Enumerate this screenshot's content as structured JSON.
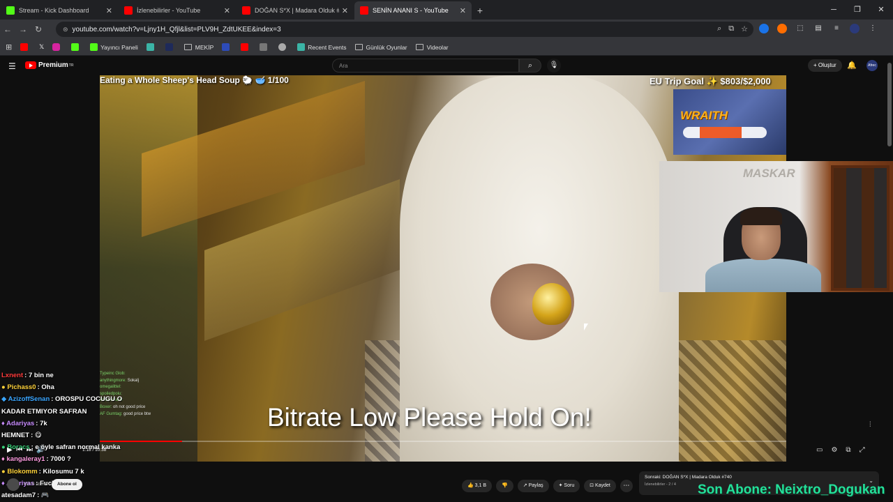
{
  "browser": {
    "tabs": [
      {
        "title": "Stream - Kick Dashboard",
        "color": "#53fc18"
      },
      {
        "title": "İzlenebilirler - YouTube",
        "color": "#ff0000"
      },
      {
        "title": "DOĞAN S*X | Madara Olduk #7",
        "color": "#ff0000"
      },
      {
        "title": "SENİN ANANI S - YouTube",
        "color": "#ff0000"
      }
    ],
    "url": "youtube.com/watch?v=Ljny1H_Qfjl&list=PLV9H_ZdtUKEE&index=3",
    "bookmarks": [
      "Yayıncı Paneli",
      "MEKİP",
      "Recent Events",
      "Günlük Oyunlar",
      "Videolar"
    ]
  },
  "youtube": {
    "logo": "Premium",
    "logo_sup": "TR",
    "search_placeholder": "Ara",
    "create_label": "Oluştur",
    "avatar_label": "Afrec"
  },
  "video": {
    "overlay_title": "Eating a Whole Sheep's Head Soup 🐑 🥣 1/100",
    "trip_goal": "EU Trip Goal ✨ $803/$2,000",
    "wraith": "WRAITH",
    "webcam_wall_logo": "MASKAR",
    "bitrate_message": "Bitrate Low Please Hold On!",
    "time": "1:18 / 10:38",
    "progress": 0.12,
    "mini_chat": [
      {
        "user": "Typeinc Glob:",
        "msg": ""
      },
      {
        "user": "anythingmore:",
        "msg": "Sokalj"
      },
      {
        "user": "omegalittel:",
        "msg": ""
      },
      {
        "user": "spoiledpoiu:",
        "msg": ""
      },
      {
        "user": "chatpassoin:",
        "msg": ""
      },
      {
        "user": "Boxer:",
        "msg": "oh not good price"
      },
      {
        "user": "AF Gumtag:",
        "msg": "good price btw"
      }
    ]
  },
  "chat": [
    {
      "user": "Lxnent",
      "color": "#ff3b3b",
      "msg": ": 7 bin ne"
    },
    {
      "user": "Pichass0",
      "color": "#ffd23a",
      "msg": ": Oha"
    },
    {
      "user": "AzizoffSenan",
      "color": "#3aa6ff",
      "msg": ": OROSPU COCUGU O"
    },
    {
      "user": "",
      "color": "#ffffff",
      "msg": "KADAR ETMIYOR SAFRAN"
    },
    {
      "user": "Adariyas",
      "color": "#c88cff",
      "msg": ": 7k"
    },
    {
      "user": "HEMNET",
      "color": "#ffffff",
      "msg": ": 😋"
    },
    {
      "user": "Boracs",
      "color": "#3ad27a",
      "msg": ": e öyle safran normal kanka"
    },
    {
      "user": "kangaleray1",
      "color": "#ff9be0",
      "msg": ": 7000 ?"
    },
    {
      "user": "Blokomm",
      "color": "#ffd23a",
      "msg": ": Kilosumu 7 k"
    },
    {
      "user": "Adariyas",
      "color": "#c88cff",
      "msg": ": Fuck amk"
    },
    {
      "user": "atesadam7",
      "color": "#ffffff",
      "msg": ": 🎮"
    }
  ],
  "actions": {
    "likes": "3,1 B",
    "share": "Paylaş",
    "ask": "Soru",
    "save": "Kaydet"
  },
  "channel": {
    "subs": "419 B abone",
    "subscribe": "Abone ol"
  },
  "upnext": {
    "title": "Sonraki: DOĞAN S*X | Madara Olduk #740",
    "sub": "İzlenebilirler - 2 / 4"
  },
  "last_sub": "Son Abone: Neixtro_Dogukan"
}
